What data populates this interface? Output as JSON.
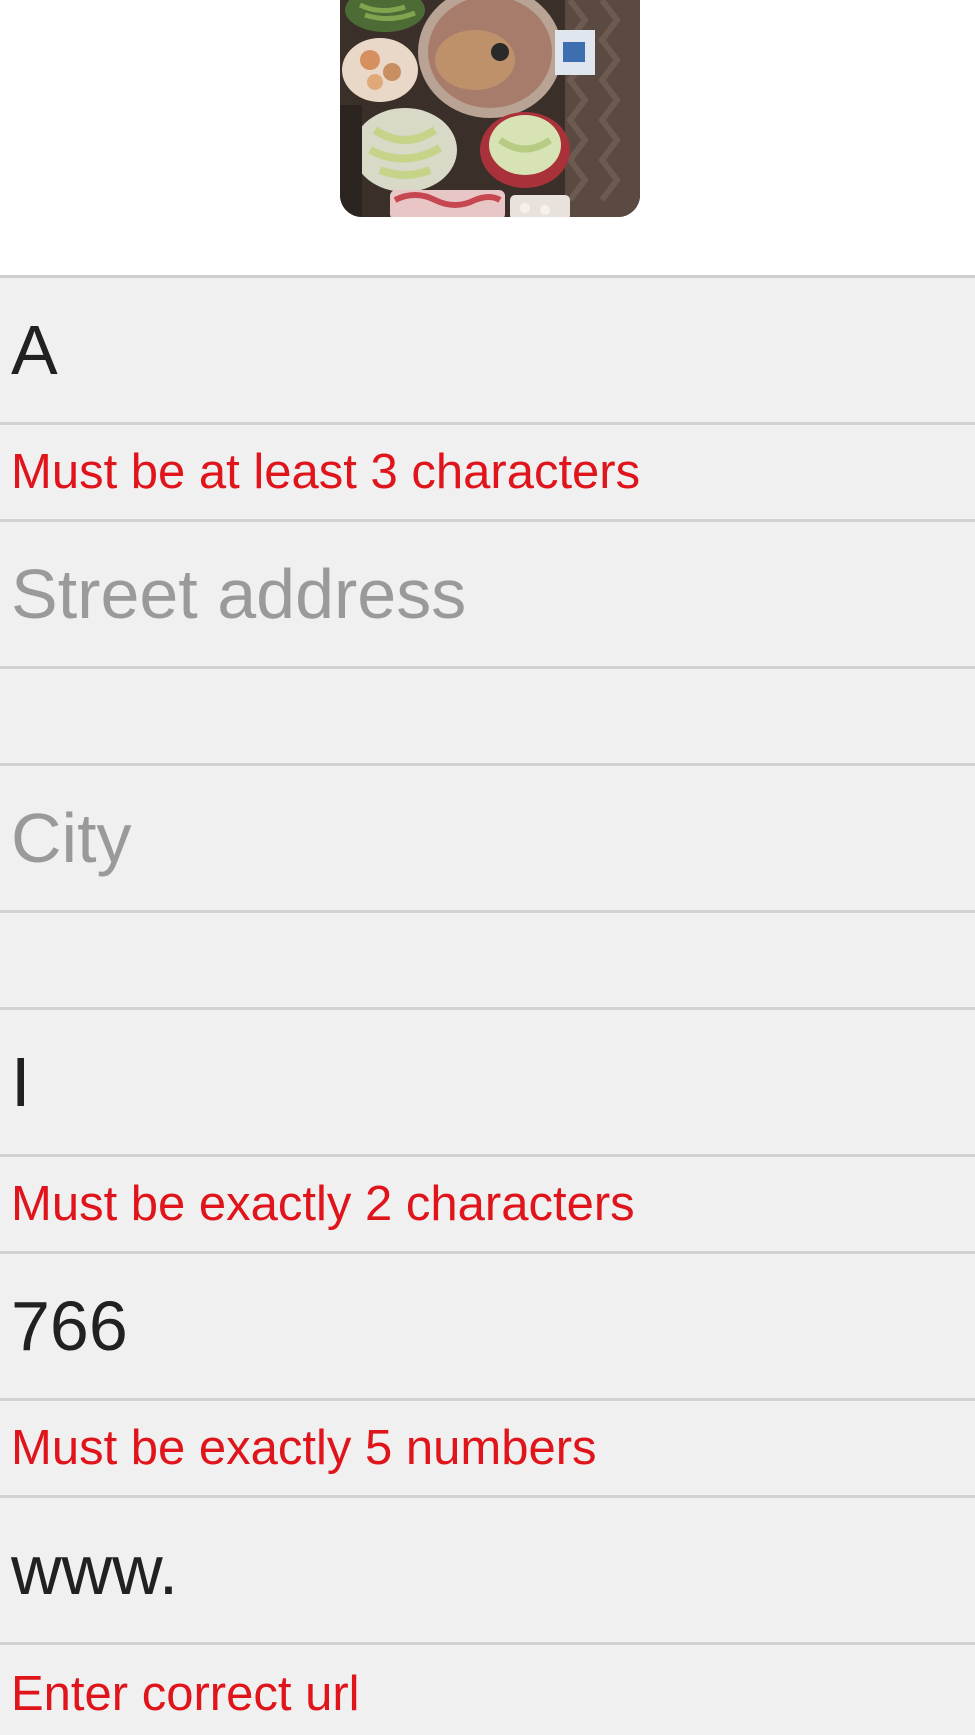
{
  "photo": {
    "alt_icon": "hotpot-photo"
  },
  "form": {
    "name_field": {
      "value": "A",
      "placeholder": ""
    },
    "name_error": "Must be at least 3 characters",
    "street_field": {
      "value": "",
      "placeholder": "Street address"
    },
    "street_error": "",
    "city_field": {
      "value": "",
      "placeholder": "City"
    },
    "city_error": "",
    "state_field": {
      "value": "I",
      "placeholder": ""
    },
    "state_error": "Must be exactly 2 characters",
    "zip_field": {
      "value": "766",
      "placeholder": ""
    },
    "zip_error": "Must be exactly 5 numbers",
    "url_field": {
      "value": "www.",
      "placeholder": ""
    },
    "url_error": "Enter correct url"
  },
  "colors": {
    "error": "#e0141b",
    "field_bg": "#f0f0f0",
    "divider": "#d2d2d2",
    "placeholder": "#9a9a9a"
  }
}
